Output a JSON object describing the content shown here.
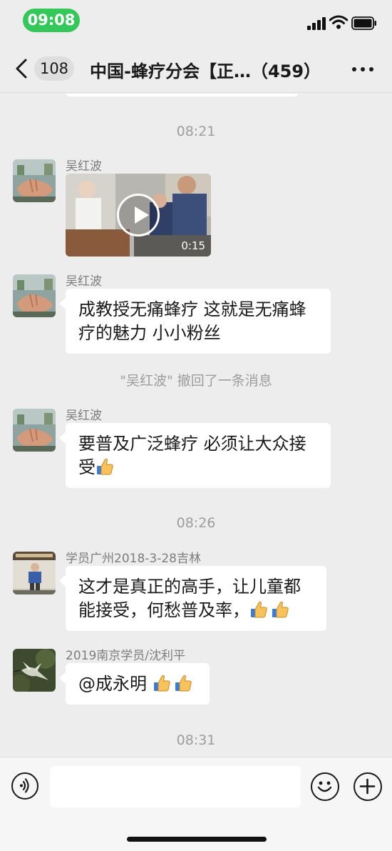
{
  "status_bar": {
    "time": "09:08",
    "icons": [
      "signal-icon",
      "wifi-icon",
      "battery-icon"
    ]
  },
  "nav": {
    "back_icon": "chevron-left-icon",
    "unread_count": "108",
    "title": "中国-蜂疗分会【正…（459）",
    "more_icon": "more-dots-icon"
  },
  "messages": [
    {
      "type": "timestamp",
      "text": "08:21"
    },
    {
      "type": "video",
      "sender": "吴红波",
      "duration": "0:15"
    },
    {
      "type": "text",
      "sender": "吴红波",
      "lines": [
        "成教授无痛蜂疗 这就是无痛蜂",
        "疗的魅力 小小粉丝"
      ]
    },
    {
      "type": "recall",
      "text": "\"吴红波\" 撤回了一条消息"
    },
    {
      "type": "text",
      "sender": "吴红波",
      "lines": [
        "要普及广泛蜂疗 必须让大众接",
        "受"
      ],
      "emoji": [
        "thumbs-up-icon"
      ]
    },
    {
      "type": "timestamp",
      "text": "08:26"
    },
    {
      "type": "text",
      "sender": "学员广州2018-3-28吉林",
      "lines": [
        "这才是真正的高手，让儿童都",
        "能接受，何愁普及率，"
      ],
      "emoji": [
        "thumbs-up-icon",
        "thumbs-up-icon"
      ]
    },
    {
      "type": "text",
      "sender": "2019南京学员/沈利平",
      "lines": [
        "@成永明 "
      ],
      "emoji": [
        "thumbs-up-icon",
        "thumbs-up-icon"
      ]
    },
    {
      "type": "timestamp",
      "text": "08:31"
    }
  ],
  "input_bar": {
    "voice_icon": "voice-icon",
    "placeholder": "",
    "emoji_icon": "smiley-icon",
    "plus_icon": "plus-circle-icon"
  },
  "colors": {
    "background": "#ededed",
    "bubble": "#ffffff",
    "time_pill": "#34c759",
    "timestamp_text": "#9d9d9d",
    "sender_text": "#7d7d7d"
  }
}
